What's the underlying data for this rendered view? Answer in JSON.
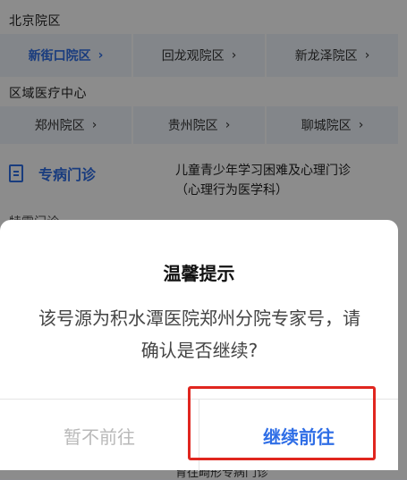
{
  "beijing": {
    "title": "北京院区",
    "items": [
      {
        "label": "新街口院区",
        "chevron": "›"
      },
      {
        "label": "回龙观院区",
        "chevron": "›"
      },
      {
        "label": "新龙泽院区",
        "chevron": "›"
      }
    ]
  },
  "regional": {
    "title": "区域医疗中心",
    "items": [
      {
        "label": "郑州院区",
        "chevron": "›"
      },
      {
        "label": "贵州院区",
        "chevron": "›"
      },
      {
        "label": "聊城院区",
        "chevron": "›"
      }
    ]
  },
  "special": {
    "label": "专病门诊",
    "item_line1": "儿童青少年学习困难及心理门诊",
    "item_line2": "（心理行为医学科）",
    "bottom_text": "育往畸形专病门诊"
  },
  "stub": {
    "text": "特需门诊"
  },
  "dialog": {
    "title": "温馨提示",
    "message": "该号源为积水潭医院郑州分院专家号，请确认是否继续?",
    "cancel_label": "暂不前往",
    "confirm_label": "继续前往"
  },
  "colors": {
    "accent": "#2f6ee6",
    "highlight": "#e0261f",
    "grid_bg": "#eef4fb"
  }
}
